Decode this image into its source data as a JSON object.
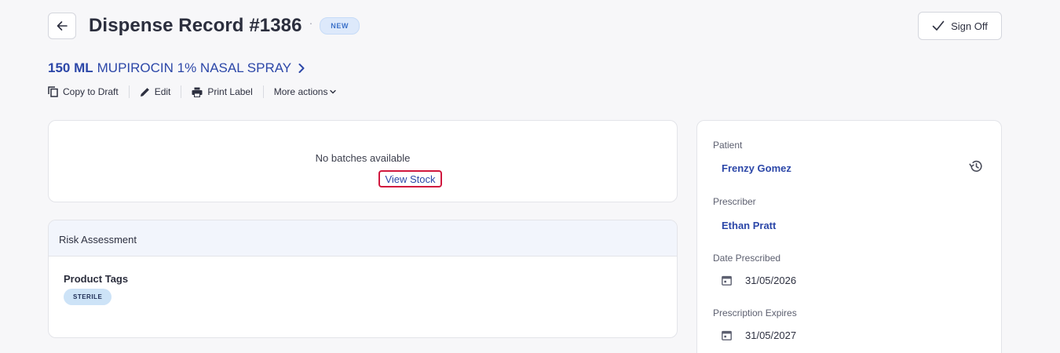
{
  "header": {
    "title": "Dispense Record #1386",
    "separator": "·",
    "badge": "NEW",
    "sign_off_label": "Sign Off"
  },
  "product": {
    "quantity": "150 ML",
    "name": "MUPIROCIN 1% NASAL SPRAY"
  },
  "actions": {
    "copy_to_draft": "Copy to Draft",
    "edit": "Edit",
    "print_label": "Print Label",
    "more_actions": "More actions"
  },
  "batches": {
    "empty_text": "No batches available",
    "view_stock_label": "View Stock"
  },
  "risk": {
    "title": "Risk Assessment",
    "tags_label": "Product Tags",
    "tags": [
      "STERILE"
    ]
  },
  "details": {
    "patient_label": "Patient",
    "patient_name": "Frenzy Gomez",
    "prescriber_label": "Prescriber",
    "prescriber_name": "Ethan Pratt",
    "date_prescribed_label": "Date Prescribed",
    "date_prescribed": "31/05/2026",
    "expires_label": "Prescription Expires",
    "expires": "31/05/2027"
  },
  "colors": {
    "link": "#2c47a8",
    "badge_bg": "#dde9fb",
    "badge_text": "#3d72c9",
    "tag_bg": "#cde3f7",
    "highlight_border": "#d0183e"
  },
  "icons": [
    "arrow-left-icon",
    "check-icon",
    "chevron-right-icon",
    "copy-icon",
    "pencil-icon",
    "printer-icon",
    "chevron-down-icon",
    "history-icon",
    "calendar-icon"
  ]
}
